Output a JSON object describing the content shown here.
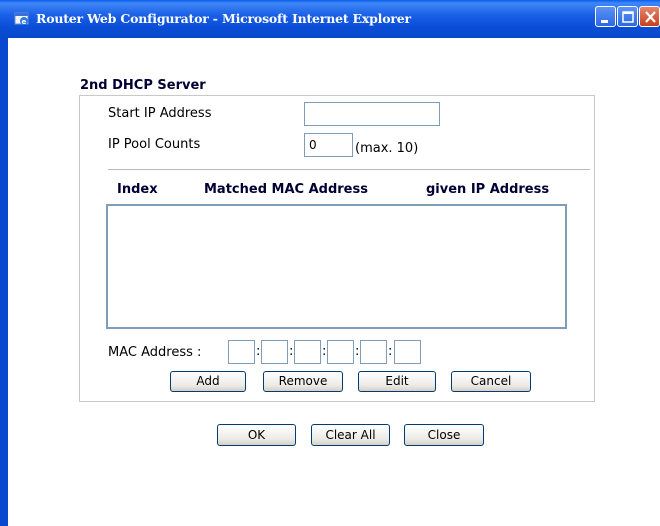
{
  "window": {
    "title": "Router Web Configurator - Microsoft Internet Explorer",
    "icon": "ie-icon",
    "controls": [
      "minimize-icon",
      "maximize-icon",
      "close-icon"
    ]
  },
  "form": {
    "section_title": "2nd DHCP Server",
    "start_ip": {
      "label": "Start IP Address",
      "value": ""
    },
    "pool_counts": {
      "label": "IP Pool Counts",
      "value": "0",
      "hint": "(max. 10)"
    },
    "table": {
      "headers": [
        "Index",
        "Matched MAC Address",
        "given IP Address"
      ],
      "rows": []
    },
    "mac": {
      "label": "MAC Address :",
      "octets": [
        "",
        "",
        "",
        "",
        "",
        ""
      ],
      "separator": ":"
    },
    "list_buttons": {
      "add": "Add",
      "remove": "Remove",
      "edit": "Edit",
      "cancel": "Cancel"
    },
    "footer_buttons": {
      "ok": "OK",
      "clear_all": "Clear All",
      "close": "Close"
    }
  },
  "colors": {
    "titlebar": "#0b4ed8",
    "close_button": "#d4502c",
    "heading": "#000033"
  }
}
